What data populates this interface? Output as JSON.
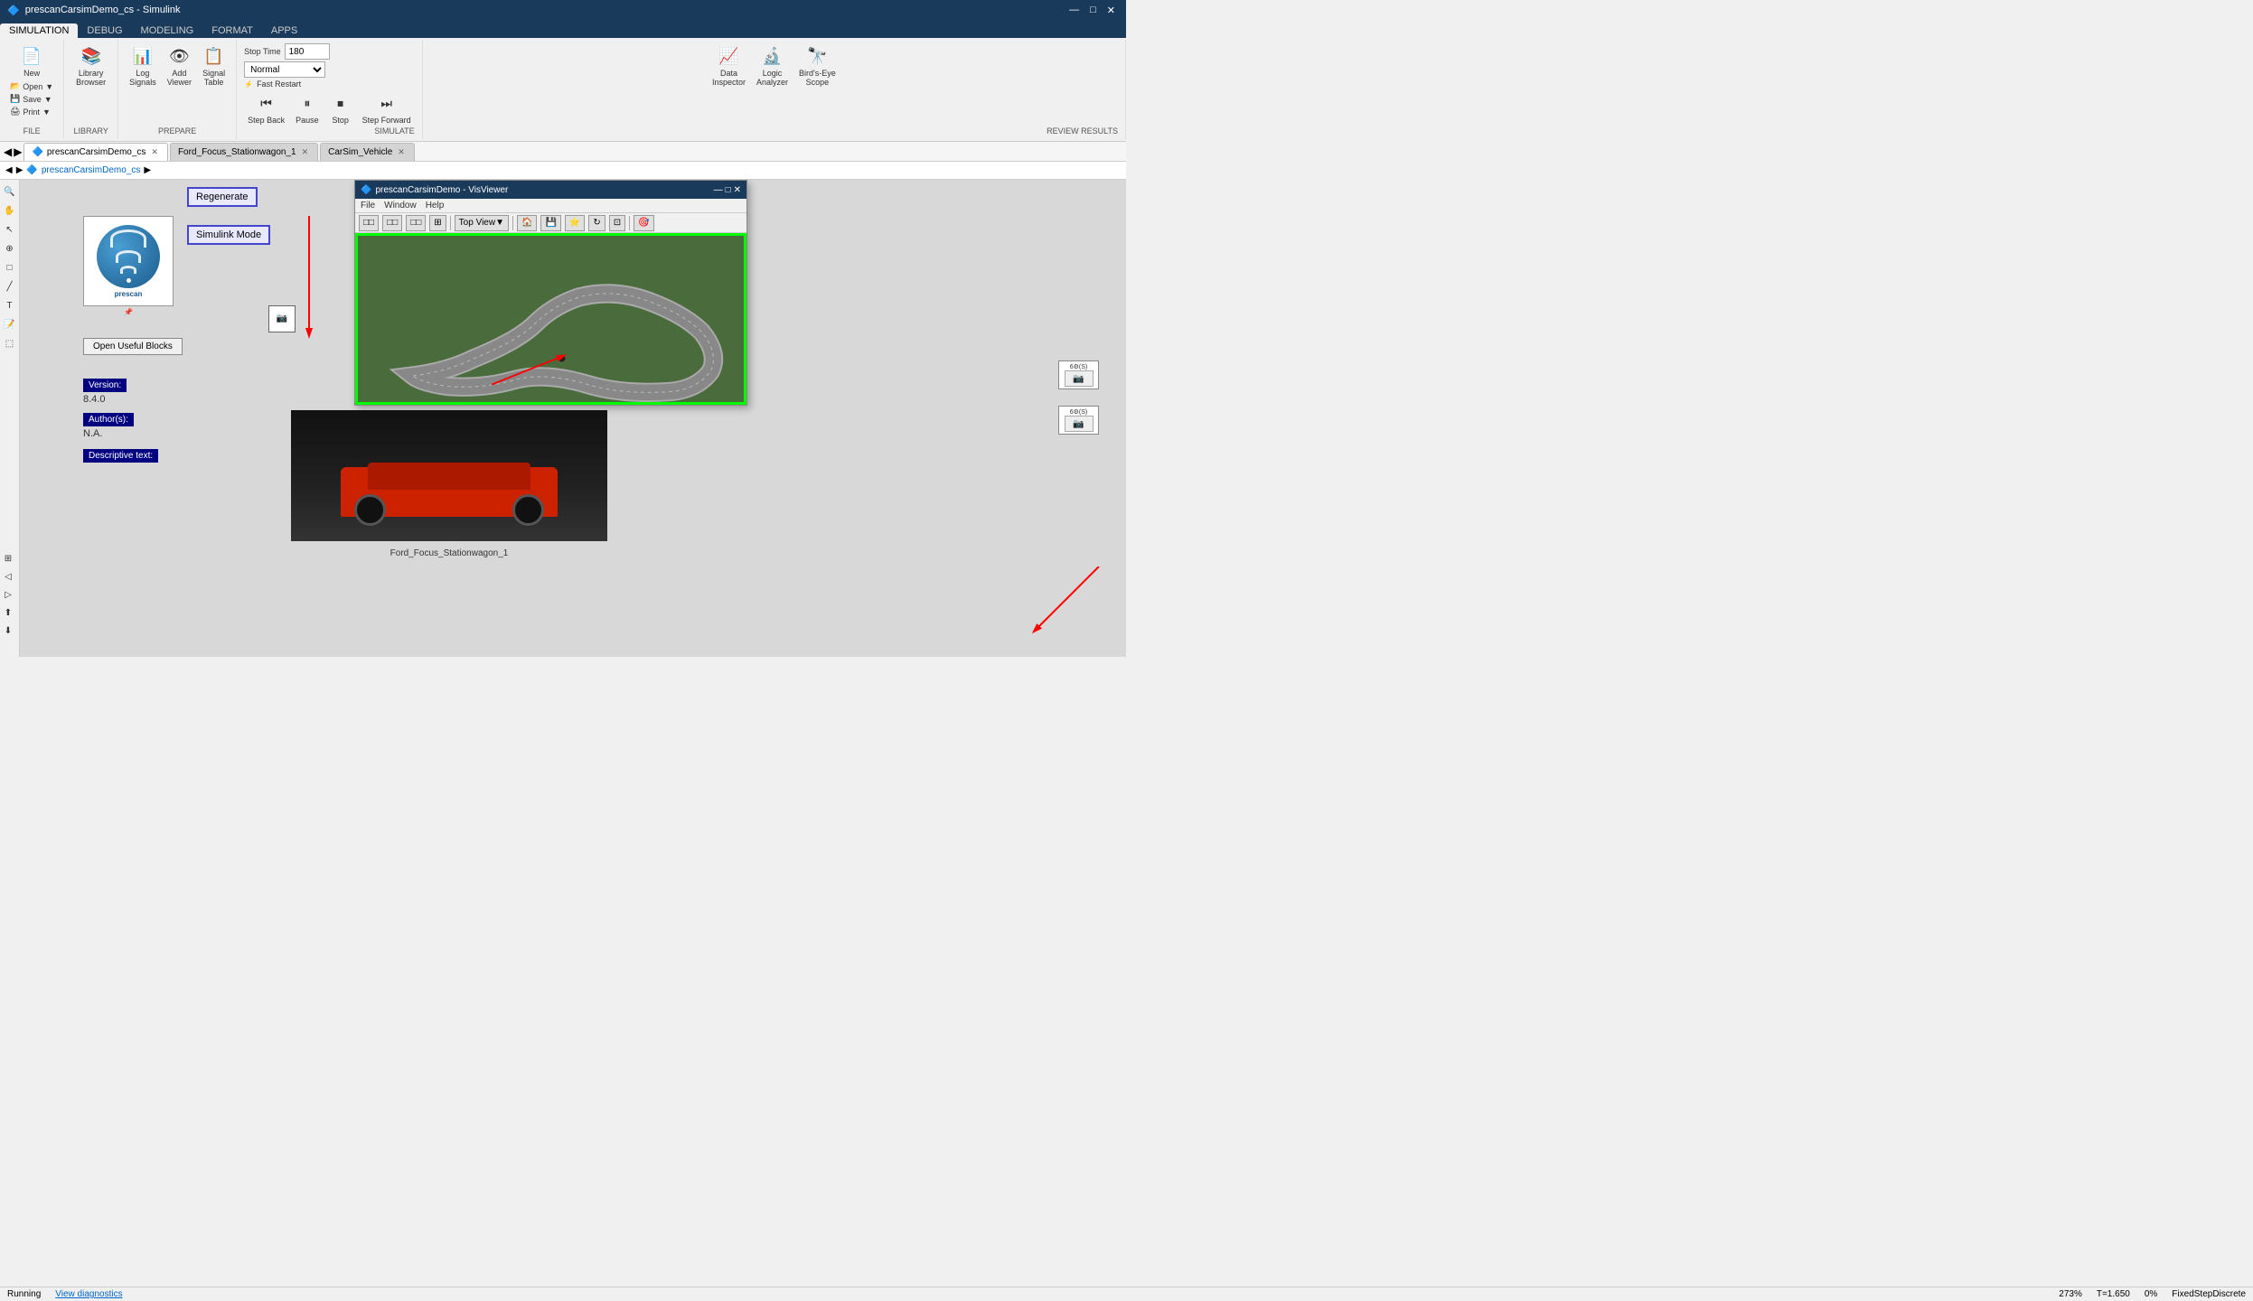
{
  "window": {
    "title": "prescanCarsimDemo_cs - Simulink",
    "controls": [
      "—",
      "□",
      "✕"
    ]
  },
  "menu_tabs": [
    {
      "label": "SIMULATION",
      "active": true
    },
    {
      "label": "DEBUG",
      "active": false
    },
    {
      "label": "MODELING",
      "active": false
    },
    {
      "label": "FORMAT",
      "active": false
    },
    {
      "label": "APPS",
      "active": false
    }
  ],
  "ribbon": {
    "file_group": {
      "label": "FILE",
      "new_label": "New",
      "open_label": "Open",
      "save_label": "Save",
      "print_label": "Print"
    },
    "library_group": {
      "label": "LIBRARY",
      "library_browser_label": "Library\nBrowser"
    },
    "prepare_group": {
      "label": "PREPARE",
      "log_signals_label": "Log\nSignals",
      "add_viewer_label": "Add\nViewer",
      "signal_table_label": "Signal\nTable"
    },
    "simulate_group": {
      "label": "SIMULATE",
      "stop_time_label": "Stop Time",
      "stop_time_value": "180",
      "mode_label": "Normal",
      "fast_restart_label": "Fast Restart",
      "step_back_label": "Step\nBack",
      "pause_label": "Pause",
      "stop_label": "Stop",
      "step_forward_label": "Step\nForward"
    },
    "review_group": {
      "label": "REVIEW RESULTS",
      "data_inspector_label": "Data\nInspector",
      "logic_analyzer_label": "Logic\nAnalyzer",
      "birds_eye_label": "Bird's-Eye\nScope"
    }
  },
  "tabs": [
    {
      "label": "prescanCarsimDemo_cs",
      "active": true,
      "closeable": true
    },
    {
      "label": "Ford_Focus_Stationwagon_1",
      "active": false,
      "closeable": true
    },
    {
      "label": "CarSim_Vehicle",
      "active": false,
      "closeable": true
    }
  ],
  "breadcrumb": {
    "model": "prescanCarsimDemo_cs",
    "separator": "▶"
  },
  "canvas": {
    "prescan_logo": "prescan",
    "regenerate_label": "Regenerate",
    "simulink_mode_label": "Simulink Mode",
    "open_useful_label": "Open Useful Blocks",
    "version_label": "Version:",
    "version_value": "8.4.0",
    "authors_label": "Author(s):",
    "authors_value": "N.A.",
    "descriptive_label": "Descriptive text:"
  },
  "vis_window": {
    "title": "prescanCarsimDemo - VisViewer",
    "menu_items": [
      "File",
      "Window",
      "Help"
    ],
    "view_label": "Top View",
    "toolbar_icons": [
      "□□",
      "□□",
      "□□",
      "□□",
      "□□"
    ],
    "footer": ""
  },
  "car_label": "Ford_Focus_Stationwagon_1",
  "blocks": [
    {
      "id": "block1",
      "label": "6⚙(S)"
    },
    {
      "id": "block2",
      "label": "6⚙(S)"
    }
  ],
  "status_bar": {
    "running_label": "Running",
    "diagnostics_label": "View diagnostics",
    "zoom_label": "273%",
    "time_label": "T=1.650",
    "percent_label": "0%",
    "fixed_step_label": "FixedStepDiscrete"
  }
}
